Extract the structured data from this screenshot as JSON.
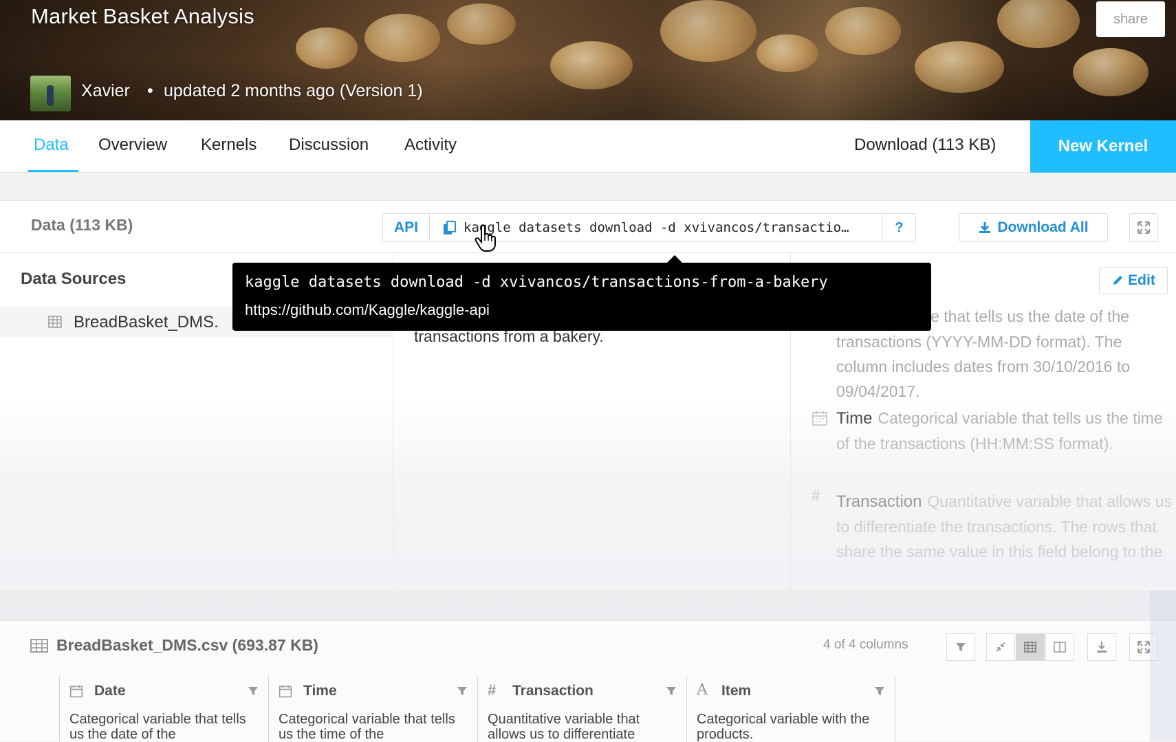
{
  "header": {
    "title": "Market Basket Analysis",
    "share_label": "share",
    "author": "Xavier",
    "separator": "•",
    "updated": "updated 2 months ago (Version 1)"
  },
  "nav": {
    "tabs": [
      "Data",
      "Overview",
      "Kernels",
      "Discussion",
      "Activity"
    ],
    "active_tab": "Data",
    "download_label": "Download (113 KB)",
    "new_kernel_label": "New Kernel",
    "accent_color": "#20beff"
  },
  "data_panel": {
    "size_label": "Data (113 KB)",
    "api_label": "API",
    "api_command": "kaggle datasets download -d xvivancos/transactio…",
    "help_label": "?",
    "download_all_label": "Download All",
    "data_sources_title": "Data Sources",
    "source_file": "BreadBasket_DMS.",
    "description_fragment": "transactions from a bakery.",
    "edit_label": "Edit",
    "columns": [
      {
        "icon": "calendar-icon",
        "name": "",
        "text": "orical variable that tells us the date of the transactions (YYYY-MM-DD format). The column includes dates from 30/10/2016 to 09/04/2017."
      },
      {
        "icon": "calendar-icon",
        "name": "Time",
        "text": "Categorical variable that tells us the time of the transactions (HH:MM:SS format)."
      },
      {
        "icon": "hash-icon",
        "name": "Transaction",
        "text": "Quantitative variable that allows us to differentiate the transactions. The rows that share the same value in this field belong to the"
      }
    ]
  },
  "tooltip": {
    "command": "kaggle datasets download -d xvivancos/transactions-from-a-bakery",
    "link": "https://github.com/Kaggle/kaggle-api"
  },
  "file_preview": {
    "file_name": "BreadBasket_DMS.csv (693.87 KB)",
    "column_count": "4 of 4 columns",
    "table_columns": [
      {
        "icon": "calendar-icon",
        "name": "Date",
        "desc": "Categorical variable that tells us the date of the"
      },
      {
        "icon": "calendar-icon",
        "name": "Time",
        "desc": "Categorical variable that tells us the time of the"
      },
      {
        "icon": "hash-icon",
        "name": "Transaction",
        "desc": "Quantitative variable that allows us to differentiate"
      },
      {
        "icon": "text-icon",
        "name": "Item",
        "desc": "Categorical variable with the products."
      }
    ]
  }
}
